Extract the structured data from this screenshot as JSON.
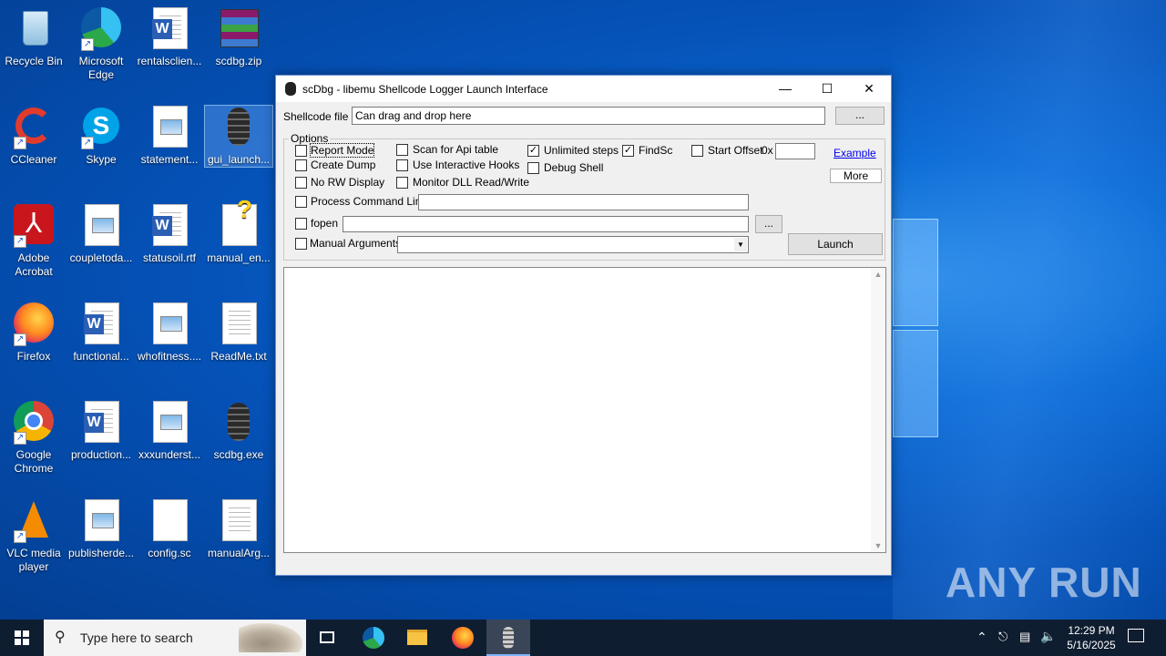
{
  "desktop": {
    "icons": [
      {
        "label": "Recycle Bin"
      },
      {
        "label": "Microsoft Edge"
      },
      {
        "label": "rentalsclien..."
      },
      {
        "label": "scdbg.zip"
      },
      {
        "label": "CCleaner"
      },
      {
        "label": "Skype"
      },
      {
        "label": "statement..."
      },
      {
        "label": "gui_launch..."
      },
      {
        "label": "Adobe Acrobat"
      },
      {
        "label": "coupletoda..."
      },
      {
        "label": "statusoil.rtf"
      },
      {
        "label": "manual_en..."
      },
      {
        "label": "Firefox"
      },
      {
        "label": "functional..."
      },
      {
        "label": "whofitness...."
      },
      {
        "label": "ReadMe.txt"
      },
      {
        "label": "Google Chrome"
      },
      {
        "label": "production..."
      },
      {
        "label": "xxxunderst..."
      },
      {
        "label": "scdbg.exe"
      },
      {
        "label": "VLC media player"
      },
      {
        "label": "publisherde..."
      },
      {
        "label": "config.sc"
      },
      {
        "label": "manualArg..."
      }
    ]
  },
  "window": {
    "title": "scDbg - libemu Shellcode Logger Launch Interface",
    "shellcode_label": "Shellcode file",
    "shellcode_value": "Can drag and drop here",
    "browse_label": "...",
    "options_label": "Options",
    "options": {
      "report_mode": {
        "label": "Report Mode",
        "checked": false
      },
      "create_dump": {
        "label": "Create Dump",
        "checked": false
      },
      "no_rw_display": {
        "label": "No RW Display",
        "checked": false
      },
      "scan_api": {
        "label": "Scan for Api table",
        "checked": false
      },
      "interactive_hooks": {
        "label": "Use Interactive Hooks",
        "checked": false
      },
      "monitor_dll": {
        "label": "Monitor DLL Read/Write",
        "checked": false
      },
      "unlimited_steps": {
        "label": "Unlimited steps",
        "checked": true
      },
      "debug_shell": {
        "label": "Debug Shell",
        "checked": false
      },
      "findsc": {
        "label": "FindSc",
        "checked": true
      },
      "start_offset": {
        "label": "Start Offset",
        "checked": false,
        "prefix": "0x",
        "value": ""
      },
      "process_cmd": {
        "label": "Process Command Line",
        "checked": false,
        "value": ""
      },
      "fopen": {
        "label": "fopen",
        "checked": false,
        "value": "",
        "browse": "..."
      },
      "manual_args": {
        "label": "Manual  Arguments",
        "checked": false,
        "value": ""
      }
    },
    "example_link": "Example",
    "more_button": "More",
    "launch_button": "Launch",
    "output_text": ""
  },
  "taskbar": {
    "search_placeholder": "Type here to search",
    "time": "12:29 PM",
    "date": "5/16/2025"
  },
  "watermark": "ANY RUN"
}
